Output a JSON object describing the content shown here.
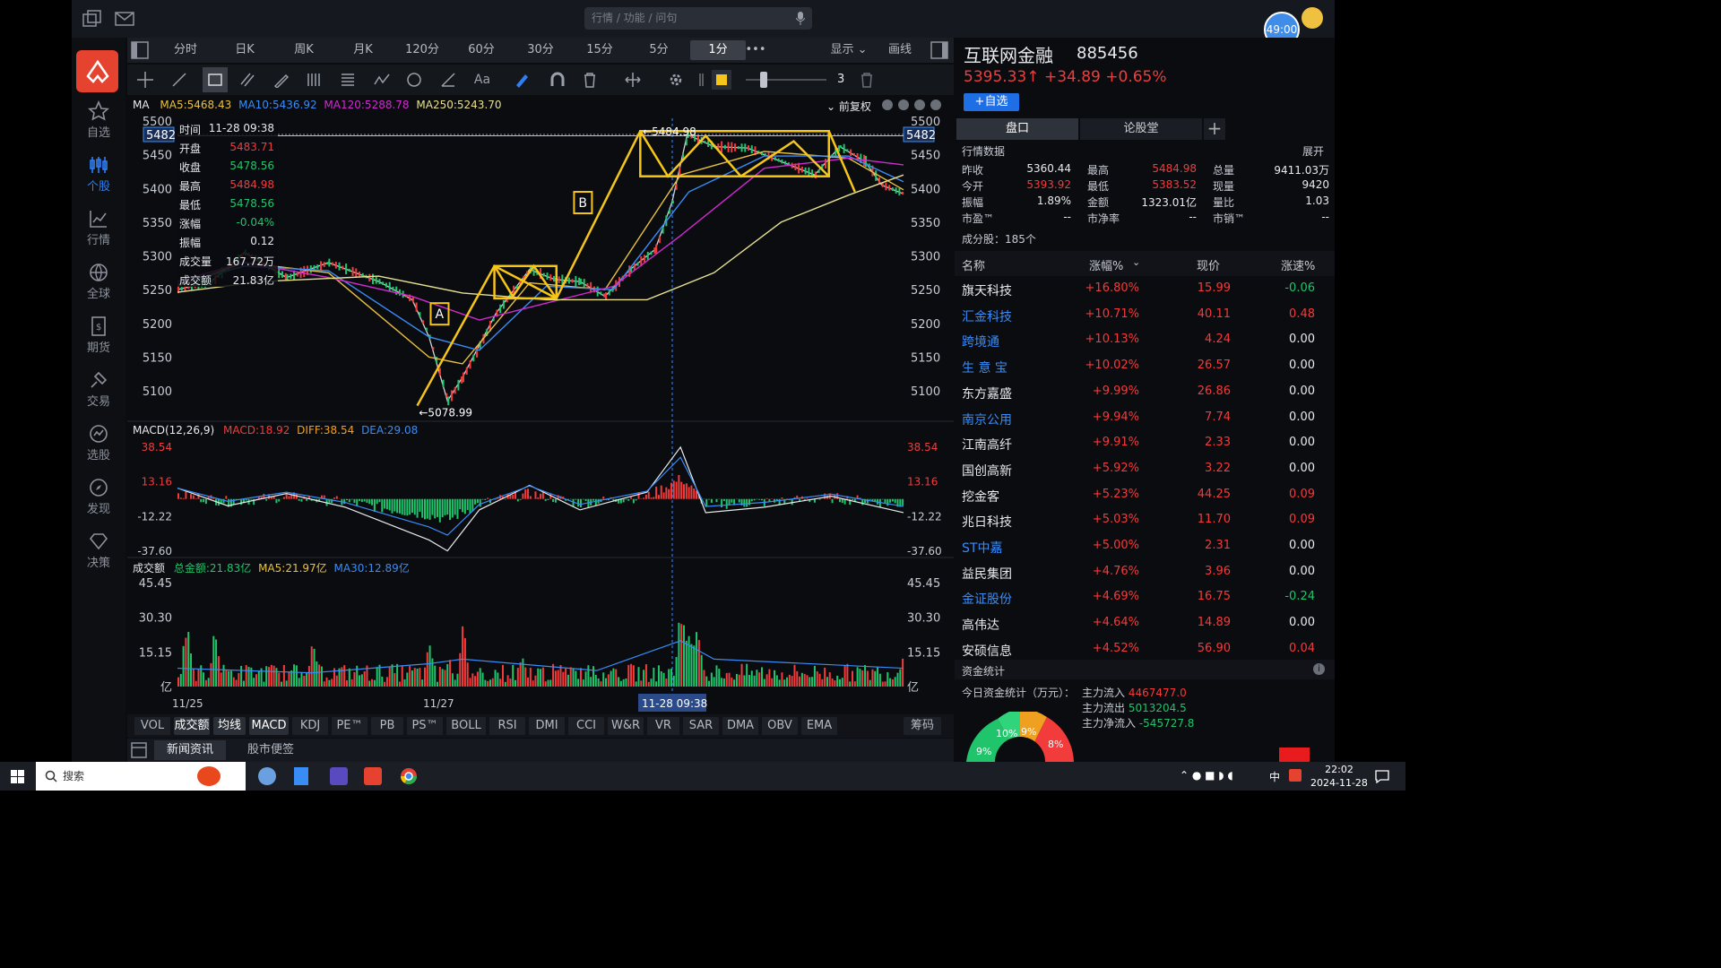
{
  "search": {
    "placeholder": "行情 / 功能 / 问句"
  },
  "timer": "49:00",
  "nav": [
    {
      "label": "自选",
      "icon": "star-icon"
    },
    {
      "label": "个股",
      "icon": "candle-icon"
    },
    {
      "label": "行情",
      "icon": "chart-icon"
    },
    {
      "label": "全球",
      "icon": "globe-icon"
    },
    {
      "label": "期货",
      "icon": "futures-icon"
    },
    {
      "label": "交易",
      "icon": "trade-icon"
    },
    {
      "label": "选股",
      "icon": "select-stock-icon"
    },
    {
      "label": "发现",
      "icon": "compass-icon"
    },
    {
      "label": "决策",
      "icon": "diamond-icon"
    }
  ],
  "periods": [
    "分时",
    "日K",
    "周K",
    "月K",
    "120分",
    "60分",
    "30分",
    "15分",
    "5分",
    "1分"
  ],
  "period_active": "1分",
  "more": "•••",
  "display_label": "显示",
  "draw_label": "画线",
  "line_width": "3",
  "ma_line": {
    "title": "MA",
    "ma5": "MA5:5468.43",
    "ma10": "MA10:5436.92",
    "ma120": "MA120:5288.78",
    "ma250": "MA250:5243.70",
    "fuquan": "前复权"
  },
  "price_axis": [
    "5500",
    "5450",
    "5400",
    "5350",
    "5300",
    "5250",
    "5200",
    "5150",
    "5100"
  ],
  "price_tag": "5482",
  "info": [
    {
      "k": "时间",
      "v": "11-28 09:38",
      "c": "white"
    },
    {
      "k": "开盘",
      "v": "5483.71",
      "c": "red"
    },
    {
      "k": "收盘",
      "v": "5478.56",
      "c": "green"
    },
    {
      "k": "最高",
      "v": "5484.98",
      "c": "red"
    },
    {
      "k": "最低",
      "v": "5478.56",
      "c": "green"
    },
    {
      "k": "涨幅",
      "v": "-0.04%",
      "c": "green"
    },
    {
      "k": "振幅",
      "v": "0.12",
      "c": "white"
    },
    {
      "k": "成交量",
      "v": "167.72万",
      "c": "white"
    },
    {
      "k": "成交额",
      "v": "21.83亿",
      "c": "white"
    }
  ],
  "annot": {
    "high": "5484.98",
    "low": "5078.99",
    "a": "A",
    "b": "B"
  },
  "macd": {
    "title": "MACD(12,26,9)",
    "macd": "MACD:18.92",
    "diff": "DIFF:38.54",
    "dea": "DEA:29.08",
    "axis": [
      "38.54",
      "13.16",
      "-12.22",
      "-37.60"
    ]
  },
  "vol": {
    "title": "成交额",
    "total": "总金额:21.83亿",
    "ma5": "MA5:21.97亿",
    "ma30": "MA30:12.89亿",
    "axis": [
      "45.45",
      "30.30",
      "15.15",
      "亿"
    ]
  },
  "dates": [
    "11/25",
    "11/27",
    "11-28 09:38"
  ],
  "indicators": [
    "VOL",
    "成交额",
    "均线",
    "MACD",
    "KDJ",
    "PE™",
    "PB",
    "PS™",
    "BOLL",
    "RSI",
    "DMI",
    "CCI",
    "W&R",
    "VR",
    "SAR",
    "DMA",
    "OBV",
    "EMA"
  ],
  "indicators_active": [
    "成交额",
    "均线",
    "MACD"
  ],
  "chip": "筹码",
  "news_tabs": [
    "新闻资讯",
    "股市便签"
  ],
  "stock": {
    "name": "互联网金融",
    "code": "885456",
    "price": "5395.33↑",
    "change": "+34.89",
    "pct": "+0.65%",
    "add": "+自选"
  },
  "rtabs": [
    "盘口",
    "论股堂",
    "+"
  ],
  "market_title": "行情数据",
  "expand": "展开",
  "quote": [
    [
      "昨收",
      "5360.44",
      "最高",
      "5484.98",
      "总量",
      "9411.03万"
    ],
    [
      "今开",
      "5393.92",
      "最低",
      "5383.52",
      "现量",
      "9420"
    ],
    [
      "振幅",
      "1.89%",
      "金额",
      "1323.01亿",
      "量比",
      "1.03"
    ],
    [
      "市盈™",
      "--",
      "市净率",
      "--",
      "市销™",
      "--"
    ]
  ],
  "constituents": "成分股：185个",
  "table_head": [
    "名称",
    "涨幅%",
    "现价",
    "涨速%"
  ],
  "rows": [
    {
      "name": "旗天科技",
      "pct": "+16.80%",
      "price": "15.99",
      "speed": "-0.06",
      "blue": false
    },
    {
      "name": "汇金科技",
      "pct": "+10.71%",
      "price": "40.11",
      "speed": "0.48",
      "blue": true
    },
    {
      "name": "跨境通",
      "pct": "+10.13%",
      "price": "4.24",
      "speed": "0.00",
      "blue": true
    },
    {
      "name": "生 意 宝",
      "pct": "+10.02%",
      "price": "26.57",
      "speed": "0.00",
      "blue": true
    },
    {
      "name": "东方嘉盛",
      "pct": "+9.99%",
      "price": "26.86",
      "speed": "0.00",
      "blue": false
    },
    {
      "name": "南京公用",
      "pct": "+9.94%",
      "price": "7.74",
      "speed": "0.00",
      "blue": true
    },
    {
      "name": "江南高纤",
      "pct": "+9.91%",
      "price": "2.33",
      "speed": "0.00",
      "blue": false
    },
    {
      "name": "国创高新",
      "pct": "+5.92%",
      "price": "3.22",
      "speed": "0.00",
      "blue": false
    },
    {
      "name": "挖金客",
      "pct": "+5.23%",
      "price": "44.25",
      "speed": "0.09",
      "blue": false
    },
    {
      "name": "兆日科技",
      "pct": "+5.03%",
      "price": "11.70",
      "speed": "0.09",
      "blue": false
    },
    {
      "name": "ST中嘉",
      "pct": "+5.00%",
      "price": "2.31",
      "speed": "0.00",
      "blue": true
    },
    {
      "name": "益民集团",
      "pct": "+4.76%",
      "price": "3.96",
      "speed": "0.00",
      "blue": false
    },
    {
      "name": "金证股份",
      "pct": "+4.69%",
      "price": "16.75",
      "speed": "-0.24",
      "blue": true
    },
    {
      "name": "高伟达",
      "pct": "+4.64%",
      "price": "14.89",
      "speed": "0.00",
      "blue": false
    },
    {
      "name": "安硕信息",
      "pct": "+4.52%",
      "price": "56.90",
      "speed": "0.04",
      "blue": false
    }
  ],
  "fund": {
    "title": "资金统计",
    "today": "今日资金统计（万元）：",
    "in_label": "主力流入",
    "in": "4467477.0",
    "out_label": "主力流出",
    "out": "5013204.5",
    "net_label": "主力净流入",
    "net": "-545727.8",
    "p1": "9%",
    "p2": "10%",
    "p3": "9%",
    "p4": "8%"
  },
  "taskbar": {
    "search": "搜索",
    "time": "22:02",
    "date": "2024-11-28",
    "ime": "中"
  },
  "colors": {
    "up": "#f23b3b",
    "down": "#1fc46b",
    "accent": "#2f7ef5",
    "annot": "#f5c518"
  }
}
